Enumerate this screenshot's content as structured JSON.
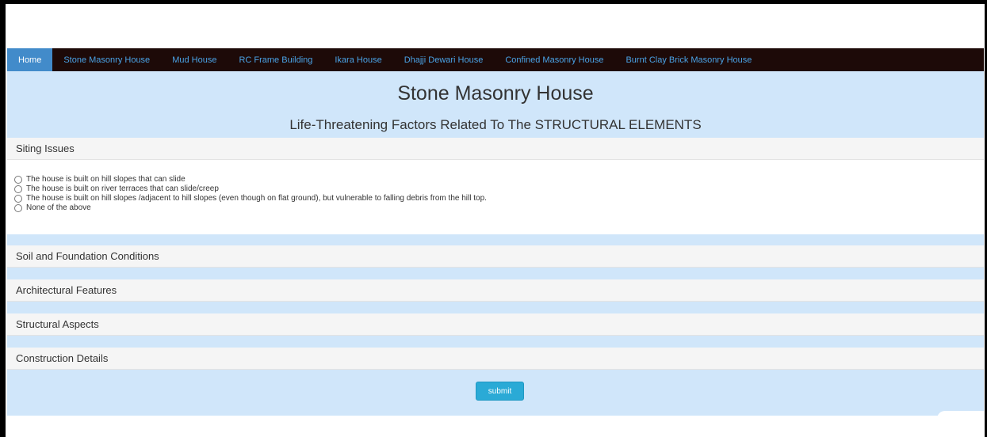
{
  "nav": {
    "items": [
      {
        "label": "Home",
        "active": true
      },
      {
        "label": "Stone Masonry House"
      },
      {
        "label": "Mud House"
      },
      {
        "label": "RC Frame Building"
      },
      {
        "label": "Ikara House"
      },
      {
        "label": "Dhajji Dewari House"
      },
      {
        "label": "Confined Masonry House"
      },
      {
        "label": "Burnt Clay Brick Masonry House"
      }
    ]
  },
  "page": {
    "title": "Stone Masonry House",
    "subtitle": "Life-Threatening Factors Related To The STRUCTURAL ELEMENTS"
  },
  "sections": [
    {
      "label": "Siting Issues",
      "expanded": true,
      "options": [
        "The house is built on hill slopes that can slide",
        "The house is built on river terraces that can slide/creep",
        "The house is built on hill slopes /adjacent to hill slopes (even though on flat ground), but vulnerable to falling debris from the hill top.",
        "None of the above"
      ]
    },
    {
      "label": "Soil and Foundation Conditions"
    },
    {
      "label": "Architectural Features"
    },
    {
      "label": "Structural Aspects"
    },
    {
      "label": "Construction Details"
    }
  ],
  "submit_label": "submit",
  "colors": {
    "navbar_bg": "#1d0a08",
    "nav_link": "#4aa3e6",
    "nav_active_bg": "#428bca",
    "panel_bg": "#d0e6fa",
    "submit_bg": "#2aaad6"
  }
}
